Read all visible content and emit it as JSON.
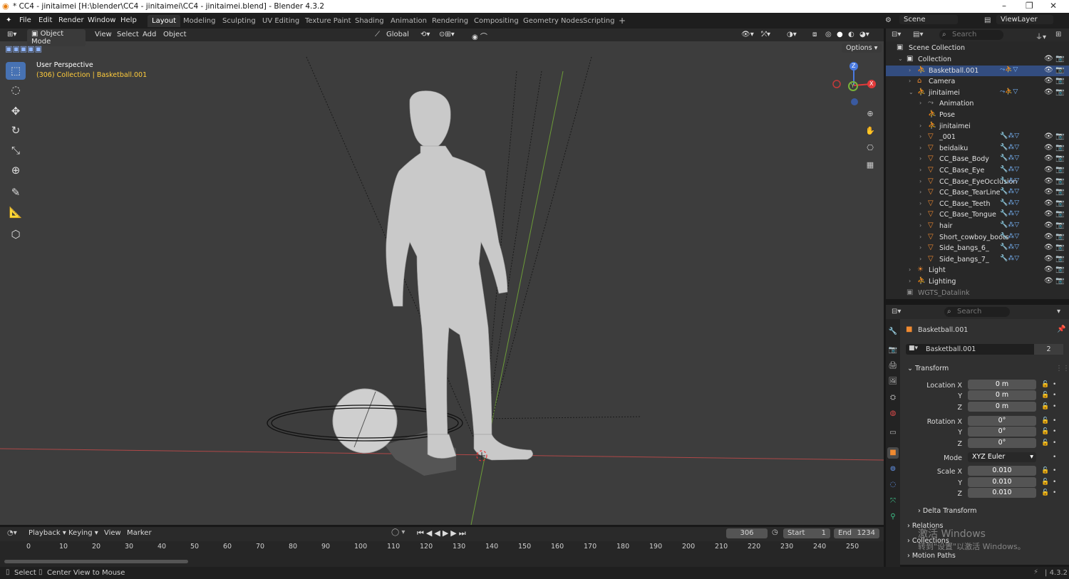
{
  "window": {
    "title": "* CC4 - jinitaimei [H:\\blender\\CC4 - jinitaimei\\CC4 - jinitaimei.blend] - Blender 4.3.2",
    "controls": [
      "–",
      "❐",
      "✕"
    ]
  },
  "menu": [
    "File",
    "Edit",
    "Render",
    "Window",
    "Help"
  ],
  "workspaces": [
    {
      "label": "Layout",
      "active": true
    },
    {
      "label": "Modeling"
    },
    {
      "label": "Sculpting"
    },
    {
      "label": "UV Editing"
    },
    {
      "label": "Texture Paint"
    },
    {
      "label": "Shading"
    },
    {
      "label": "Animation"
    },
    {
      "label": "Rendering"
    },
    {
      "label": "Compositing"
    },
    {
      "label": "Geometry Nodes"
    },
    {
      "label": "Scripting"
    }
  ],
  "add_workspace": "+",
  "scene": {
    "label": "Scene",
    "viewlayer": "ViewLayer"
  },
  "viewport_header": {
    "mode": "Object Mode",
    "menus": [
      "View",
      "Select",
      "Add",
      "Object"
    ],
    "orientation": "Global",
    "options": "Options"
  },
  "viewport": {
    "perspective": "User Perspective",
    "context_frame": "(306) Collection",
    "context_object": "Basketball.001",
    "gizmo": {
      "x": "X",
      "y": "Y",
      "z": "Z"
    }
  },
  "outliner": {
    "search_placeholder": "Search",
    "scene_collection": "Scene Collection",
    "rows": [
      {
        "label": "Collection",
        "depth": 1,
        "type": "collection"
      },
      {
        "label": "Basketball.001",
        "depth": 2,
        "type": "armature",
        "selected": true
      },
      {
        "label": "Camera",
        "depth": 2,
        "type": "camera"
      },
      {
        "label": "jinitaimei",
        "depth": 2,
        "type": "armature",
        "expanded": true
      },
      {
        "label": "Animation",
        "depth": 3,
        "type": "anim"
      },
      {
        "label": "Pose",
        "depth": 3,
        "type": "pose"
      },
      {
        "label": "jinitaimei",
        "depth": 3,
        "type": "armdata"
      },
      {
        "label": "_001",
        "depth": 3,
        "type": "mesh"
      },
      {
        "label": "beidaiku",
        "depth": 3,
        "type": "mesh"
      },
      {
        "label": "CC_Base_Body",
        "depth": 3,
        "type": "mesh"
      },
      {
        "label": "CC_Base_Eye",
        "depth": 3,
        "type": "mesh"
      },
      {
        "label": "CC_Base_EyeOcclusion",
        "depth": 3,
        "type": "mesh"
      },
      {
        "label": "CC_Base_TearLine",
        "depth": 3,
        "type": "mesh"
      },
      {
        "label": "CC_Base_Teeth",
        "depth": 3,
        "type": "mesh"
      },
      {
        "label": "CC_Base_Tongue",
        "depth": 3,
        "type": "mesh"
      },
      {
        "label": "hair",
        "depth": 3,
        "type": "mesh"
      },
      {
        "label": "Short_cowboy_boots",
        "depth": 3,
        "type": "mesh"
      },
      {
        "label": "Side_bangs_6_",
        "depth": 3,
        "type": "mesh"
      },
      {
        "label": "Side_bangs_7_",
        "depth": 3,
        "type": "mesh"
      },
      {
        "label": "Light",
        "depth": 2,
        "type": "light"
      },
      {
        "label": "Lighting",
        "depth": 2,
        "type": "lighting"
      },
      {
        "label": "WGTS_Datalink",
        "depth": 1,
        "type": "collection-dim"
      }
    ]
  },
  "properties": {
    "search_placeholder": "Search",
    "object_name": "Basketball.001",
    "data_name": "Basketball.001",
    "users": "2",
    "transform_label": "Transform",
    "location_label": "Location X",
    "rotation_label": "Rotation X",
    "scale_label": "Scale X",
    "mode_label": "Mode",
    "y_label": "Y",
    "z_label": "Z",
    "location": [
      "0 m",
      "0 m",
      "0 m"
    ],
    "rotation": [
      "0°",
      "0°",
      "0°"
    ],
    "mode": "XYZ Euler",
    "scale": [
      "0.010",
      "0.010",
      "0.010"
    ],
    "sections": [
      "Delta Transform",
      "Relations",
      "Collections",
      "Motion Paths"
    ],
    "watermark": [
      "激活 Windows",
      "转到\"设置\"以激活 Windows。"
    ]
  },
  "timeline": {
    "menus": [
      "Playback",
      "Keying",
      "View",
      "Marker"
    ],
    "current_frame": "306",
    "start_label": "Start",
    "start": "1",
    "end_label": "End",
    "end": "1234",
    "ticks": [
      "0",
      "10",
      "20",
      "30",
      "40",
      "50",
      "60",
      "70",
      "80",
      "90",
      "100",
      "110",
      "120",
      "130",
      "140",
      "150",
      "160",
      "170",
      "180",
      "190",
      "200",
      "210",
      "220",
      "230",
      "240",
      "250"
    ]
  },
  "status": {
    "select": "Select",
    "center": "Center View to Mouse",
    "version": "4.3.2"
  },
  "colors": {
    "accent": "#4772b3",
    "selected_row": "#334d80",
    "context_text": "#ffcc3c",
    "mesh_icon": "#f08a30"
  }
}
